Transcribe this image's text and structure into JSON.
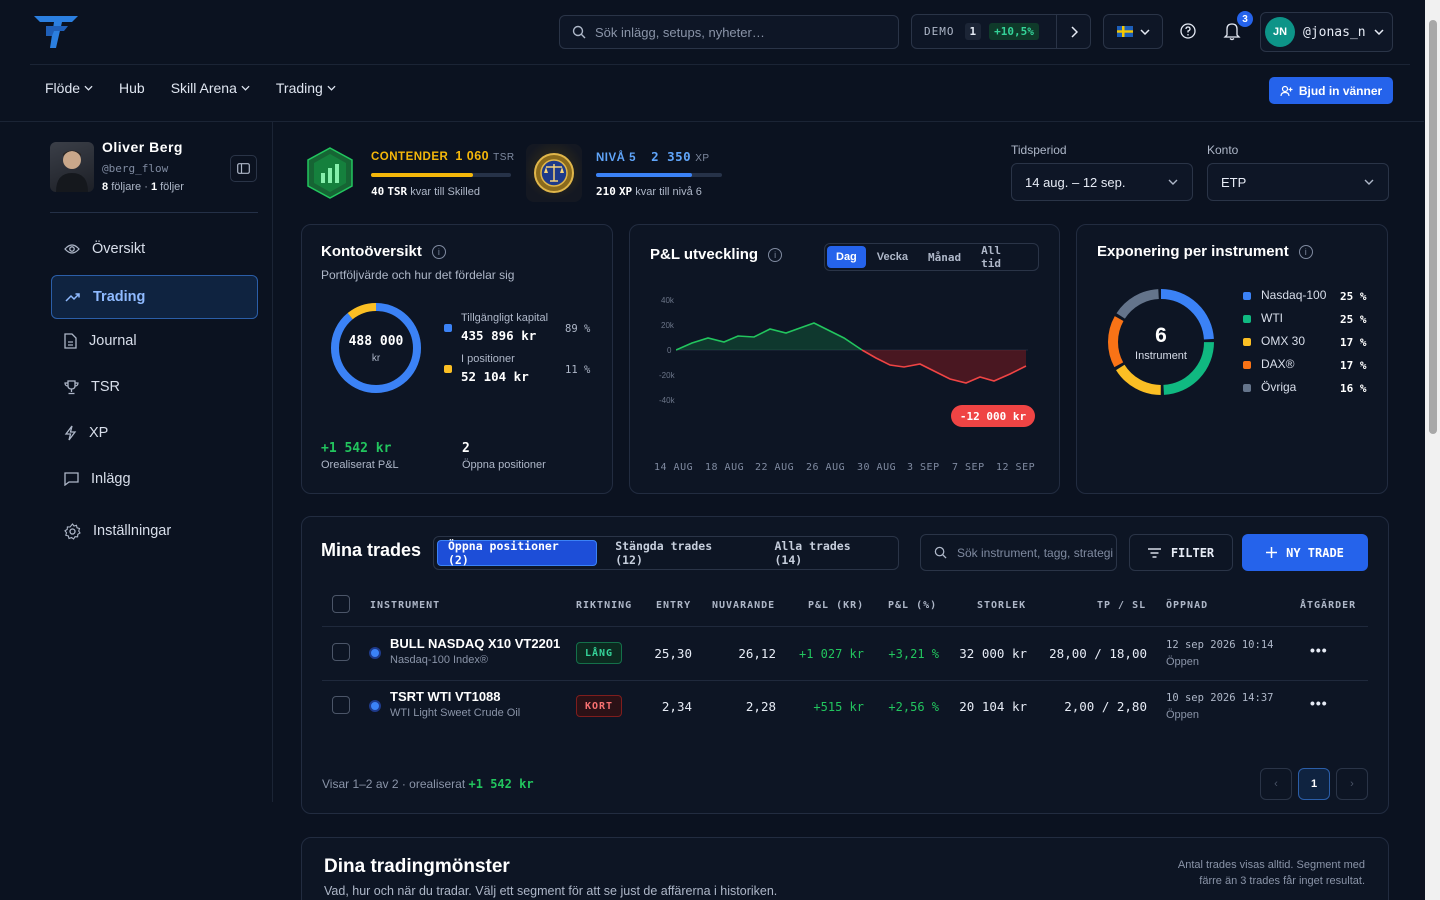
{
  "topbar": {
    "search_placeholder": "Sök inlägg, setups, nyheter…",
    "demo_label": "DEMO",
    "demo_count": "1",
    "demo_pct": "+10,5%",
    "notif_count": "3",
    "user_initials": "JN",
    "user_handle": "@jonas_n"
  },
  "nav": {
    "items": [
      "Flöde",
      "Hub",
      "Skill Arena",
      "Trading"
    ],
    "invite_label": "Bjud in vänner"
  },
  "profile": {
    "name": "Oliver Berg",
    "handle": "@berg_flow",
    "followers": "8",
    "followers_label": "följare ·",
    "following": "1",
    "following_label": "följer"
  },
  "sidebar": {
    "items": [
      {
        "label": "Översikt",
        "icon": "eye-icon"
      },
      {
        "label": "Trading",
        "icon": "trend-up-icon"
      },
      {
        "label": "Journal",
        "icon": "document-icon"
      },
      {
        "label": "TSR",
        "icon": "trophy-icon"
      },
      {
        "label": "XP",
        "icon": "bolt-icon"
      },
      {
        "label": "Inlägg",
        "icon": "chat-icon"
      },
      {
        "label": "Inställningar",
        "icon": "gear-icon"
      }
    ],
    "active_index": 1
  },
  "rank": {
    "tsr_tier": "CONTENDER",
    "tsr_value": "1 060",
    "tsr_unit": "TSR",
    "tsr_progress": 0.73,
    "tsr_remaining": "40",
    "tsr_remaining_unit": "TSR",
    "tsr_remaining_text": "kvar till Skilled",
    "xp_level": "NIVÅ 5",
    "xp_value": "2 350",
    "xp_unit": "XP",
    "xp_progress": 0.76,
    "xp_remaining": "210",
    "xp_remaining_unit": "XP",
    "xp_remaining_text": "kvar till nivå 6"
  },
  "filters": {
    "period_label": "Tidsperiod",
    "period_value": "14 aug. – 12 sep.",
    "account_label": "Konto",
    "account_value": "ETP"
  },
  "overview": {
    "title": "Kontoöversikt",
    "subtitle": "Portföljvärde och hur det fördelar sig",
    "total": "488 000",
    "total_unit": "kr",
    "available_label": "Tillgängligt kapital",
    "available_value": "435 896 kr",
    "available_pct": "89 %",
    "positions_label": "I positioner",
    "positions_value": "52 104 kr",
    "positions_pct": "11 %",
    "unrealized_value": "+1 542 kr",
    "unrealized_label": "Orealiserat P&L",
    "open_count": "2",
    "open_label": "Öppna positioner",
    "colors": {
      "available": "#3b82f6",
      "positions": "#fbbf24"
    }
  },
  "pnl": {
    "title": "P&L utveckling",
    "ranges": [
      "Dag",
      "Vecka",
      "Månad",
      "All tid"
    ],
    "active_range": 0,
    "current_value": "-12 000 kr",
    "x_labels": [
      "14 AUG",
      "18 AUG",
      "22 AUG",
      "26 AUG",
      "30 AUG",
      "3 SEP",
      "7 SEP",
      "12 SEP"
    ],
    "y_labels": [
      "40k",
      "20k",
      "0",
      "-20k",
      "-40k"
    ]
  },
  "exposure": {
    "title": "Exponering per instrument",
    "count": "6",
    "count_label": "Instrument",
    "items": [
      {
        "name": "Nasdaq-100",
        "pct": "25 %",
        "color": "#3b82f6"
      },
      {
        "name": "WTI",
        "pct": "25 %",
        "color": "#10b981"
      },
      {
        "name": "OMX 30",
        "pct": "17 %",
        "color": "#fbbf24"
      },
      {
        "name": "DAX®",
        "pct": "17 %",
        "color": "#f97316"
      },
      {
        "name": "Övriga",
        "pct": "16 %",
        "color": "#64748b"
      }
    ]
  },
  "trades": {
    "title": "Mina trades",
    "tabs": [
      "Öppna positioner (2)",
      "Stängda trades (12)",
      "Alla trades (14)"
    ],
    "active_tab": 0,
    "search_placeholder": "Sök instrument, tagg, strategi",
    "filter_label": "FILTER",
    "new_label": "NY TRADE",
    "columns": [
      "INSTRUMENT",
      "RIKTNING",
      "ENTRY",
      "NUVARANDE",
      "P&L (KR)",
      "P&L (%)",
      "STORLEK",
      "TP / SL",
      "ÖPPNAD",
      "ÅTGÄRDER"
    ],
    "rows": [
      {
        "name": "BULL NASDAQ X10 VT2201",
        "sub": "Nasdaq-100 Index®",
        "direction": "LÅNG",
        "entry": "25,30",
        "current": "26,12",
        "pnl": "+1 027 kr",
        "pnl_pct": "+3,21 %",
        "size": "32 000 kr",
        "tpsl": "28,00 / 18,00",
        "opened": "12 sep 2026 10:14",
        "status": "Öppen"
      },
      {
        "name": "TSRT WTI VT1088",
        "sub": "WTI Light Sweet Crude Oil",
        "direction": "KORT",
        "entry": "2,34",
        "current": "2,28",
        "pnl": "+515 kr",
        "pnl_pct": "+2,56 %",
        "size": "20 104 kr",
        "tpsl": "2,00 / 2,80",
        "opened": "10 sep 2026 14:37",
        "status": "Öppen"
      }
    ],
    "footer_prefix": "Visar 1–2 av 2 · orealiserat",
    "footer_value": "+1 542 kr",
    "page": "1",
    "prev_label": "‹",
    "next_label": "›"
  },
  "patterns": {
    "title": "Dina tradingmönster",
    "subtitle": "Vad, hur och när du tradar. Välj ett segment för att se just de affärerna i historiken.",
    "note": "Antal trades visas alltid. Segment med färre än 3 trades får inget resultat."
  }
}
